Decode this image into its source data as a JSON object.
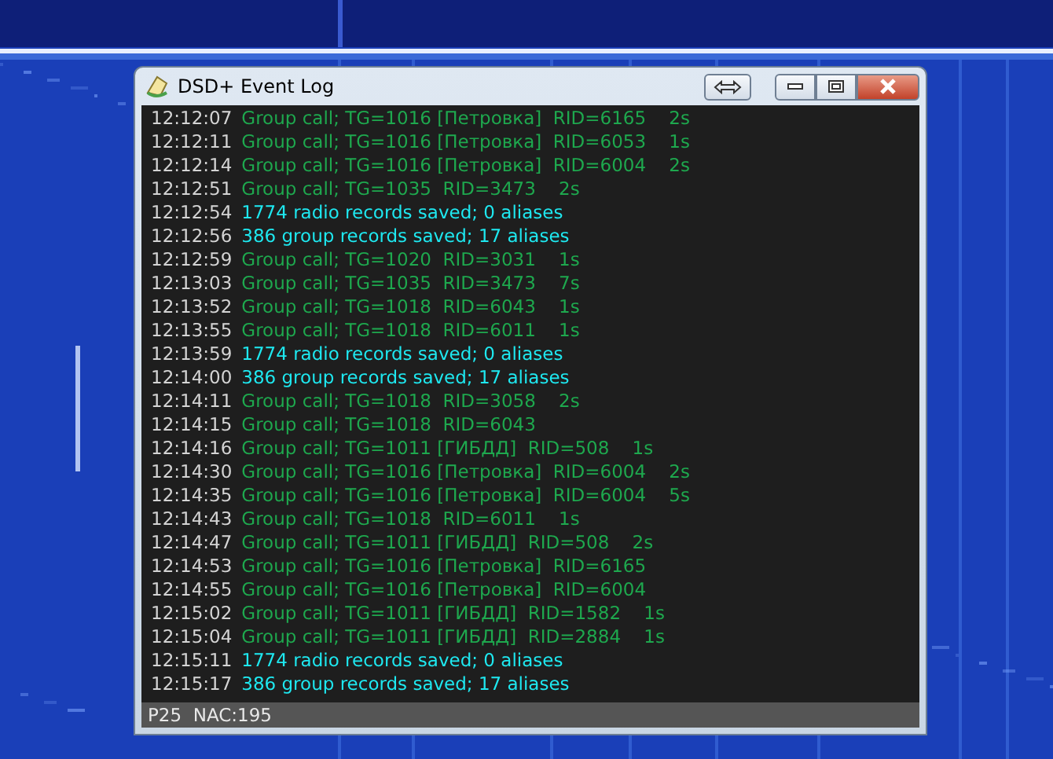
{
  "window": {
    "title": "DSD+ Event Log"
  },
  "log": [
    {
      "time": "12:12:07",
      "kind": "call",
      "message": "Group call; TG=1016 [Петровка]  RID=6165    2s"
    },
    {
      "time": "12:12:11",
      "kind": "call",
      "message": "Group call; TG=1016 [Петровка]  RID=6053    1s"
    },
    {
      "time": "12:12:14",
      "kind": "call",
      "message": "Group call; TG=1016 [Петровка]  RID=6004    2s"
    },
    {
      "time": "12:12:51",
      "kind": "call",
      "message": "Group call; TG=1035  RID=3473    2s"
    },
    {
      "time": "12:12:54",
      "kind": "info",
      "message": "1774 radio records saved; 0 aliases"
    },
    {
      "time": "12:12:56",
      "kind": "info",
      "message": "386 group records saved; 17 aliases"
    },
    {
      "time": "12:12:59",
      "kind": "call",
      "message": "Group call; TG=1020  RID=3031    1s"
    },
    {
      "time": "12:13:03",
      "kind": "call",
      "message": "Group call; TG=1035  RID=3473    7s"
    },
    {
      "time": "12:13:52",
      "kind": "call",
      "message": "Group call; TG=1018  RID=6043    1s"
    },
    {
      "time": "12:13:55",
      "kind": "call",
      "message": "Group call; TG=1018  RID=6011    1s"
    },
    {
      "time": "12:13:59",
      "kind": "info",
      "message": "1774 radio records saved; 0 aliases"
    },
    {
      "time": "12:14:00",
      "kind": "info",
      "message": "386 group records saved; 17 aliases"
    },
    {
      "time": "12:14:11",
      "kind": "call",
      "message": "Group call; TG=1018  RID=3058    2s"
    },
    {
      "time": "12:14:15",
      "kind": "call",
      "message": "Group call; TG=1018  RID=6043"
    },
    {
      "time": "12:14:16",
      "kind": "call",
      "message": "Group call; TG=1011 [ГИБДД]  RID=508    1s"
    },
    {
      "time": "12:14:30",
      "kind": "call",
      "message": "Group call; TG=1016 [Петровка]  RID=6004    2s"
    },
    {
      "time": "12:14:35",
      "kind": "call",
      "message": "Group call; TG=1016 [Петровка]  RID=6004    5s"
    },
    {
      "time": "12:14:43",
      "kind": "call",
      "message": "Group call; TG=1018  RID=6011    1s"
    },
    {
      "time": "12:14:47",
      "kind": "call",
      "message": "Group call; TG=1011 [ГИБДД]  RID=508    2s"
    },
    {
      "time": "12:14:53",
      "kind": "call",
      "message": "Group call; TG=1016 [Петровка]  RID=6165"
    },
    {
      "time": "12:14:55",
      "kind": "call",
      "message": "Group call; TG=1016 [Петровка]  RID=6004"
    },
    {
      "time": "12:15:02",
      "kind": "call",
      "message": "Group call; TG=1011 [ГИБДД]  RID=1582    1s"
    },
    {
      "time": "12:15:04",
      "kind": "call",
      "message": "Group call; TG=1011 [ГИБДД]  RID=2884    1s"
    },
    {
      "time": "12:15:11",
      "kind": "info",
      "message": "1774 radio records saved; 0 aliases"
    },
    {
      "time": "12:15:17",
      "kind": "info",
      "message": "386 group records saved; 17 aliases"
    }
  ],
  "status_bar": "P25  NAC:195"
}
